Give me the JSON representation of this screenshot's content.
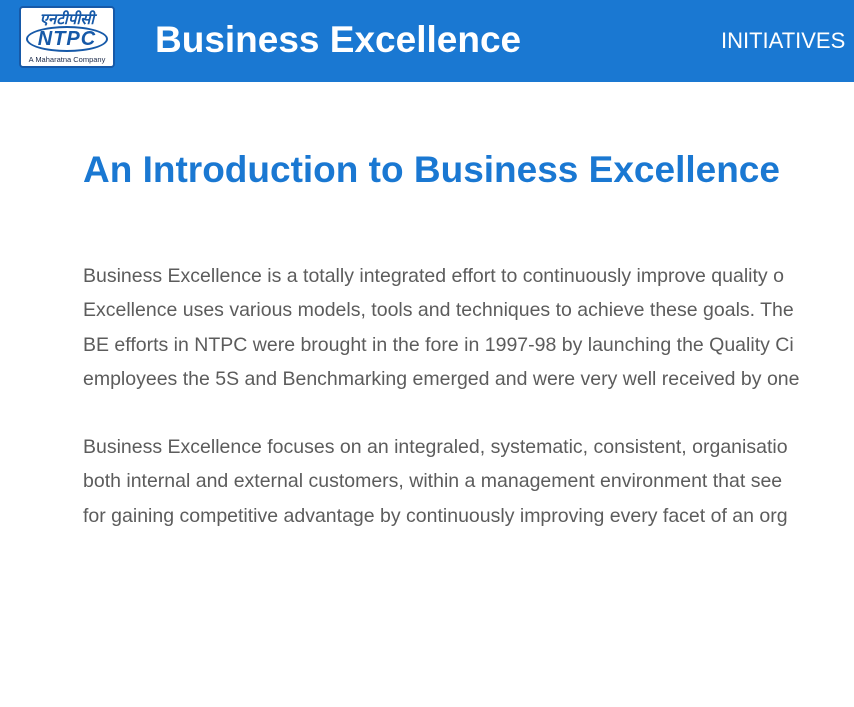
{
  "header": {
    "logo": {
      "hindi_text": "एनटीपीसी",
      "brand": "NTPC",
      "tagline": "A Maharatna Company"
    },
    "site_title": "Business Excellence",
    "nav": [
      "INITIATIVES"
    ]
  },
  "main": {
    "heading": "An Introduction to Business Excellence",
    "paragraphs": [
      {
        "lines": [
          "Business Excellence is a totally integrated effort to continuously improve quality o",
          "Excellence uses various models, tools and techniques to achieve these goals. The",
          "BE efforts in NTPC were brought in the fore in 1997-98 by launching the Quality Ci",
          "employees the 5S and Benchmarking emerged and were very well received by one"
        ]
      },
      {
        "lines": [
          "Business Excellence focuses on an integraled, systematic, consistent, organisatio",
          "both internal and external customers, within a management environment that see",
          "for gaining competitive advantage by continuously improving every facet of an org"
        ]
      }
    ]
  },
  "colors": {
    "header_bg": "#1a78d2",
    "heading": "#1a78d2",
    "body_text": "#5c5c5c",
    "logo_blue": "#1659a8"
  }
}
